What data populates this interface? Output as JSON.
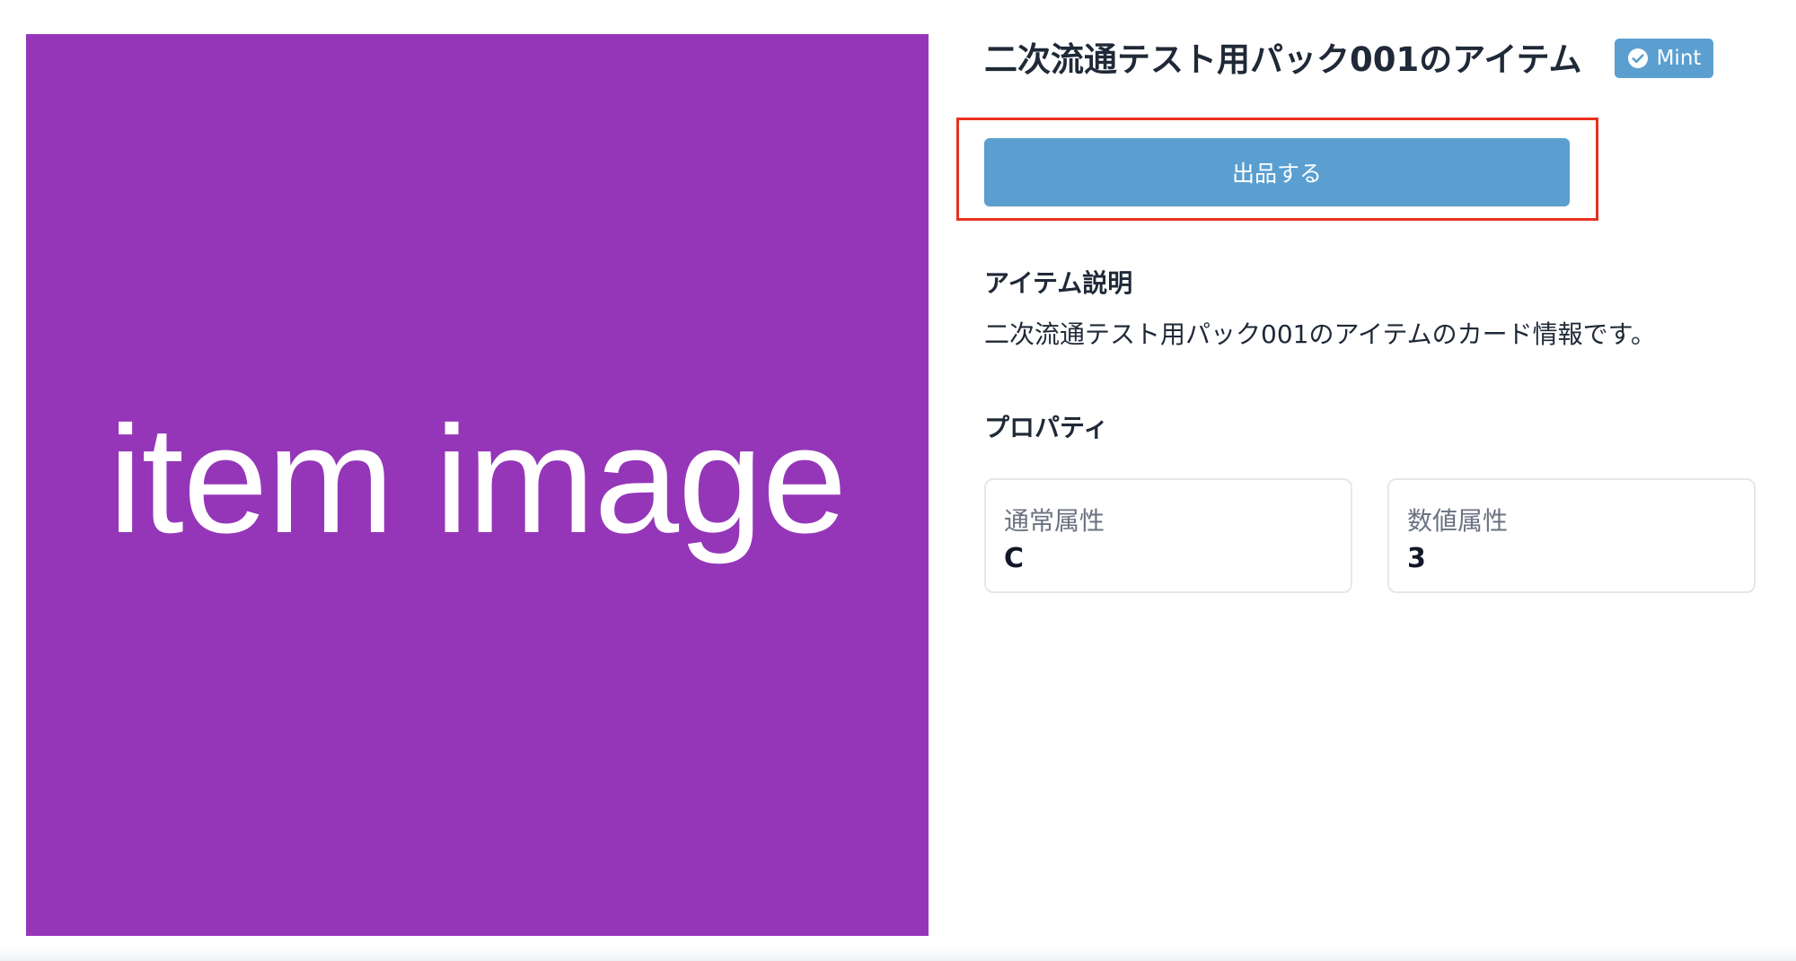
{
  "item": {
    "image_text": "item image",
    "title": "二次流通テスト用パック001のアイテム",
    "badge": "Mint",
    "badge_icon": "check-circle-icon"
  },
  "actions": {
    "list_button_label": "出品する"
  },
  "description_section": {
    "heading": "アイテム説明",
    "text": "二次流通テスト用パック001のアイテムのカード情報です。"
  },
  "properties_section": {
    "heading": "プロパティ",
    "items": [
      {
        "label": "通常属性",
        "value": "C"
      },
      {
        "label": "数値属性",
        "value": "3"
      }
    ]
  },
  "colors": {
    "image_background": "#9536B9",
    "accent_blue": "#5A9FD0",
    "highlight_red": "#E8301E",
    "text_dark": "#1F2937",
    "text_muted": "#6B7280"
  }
}
